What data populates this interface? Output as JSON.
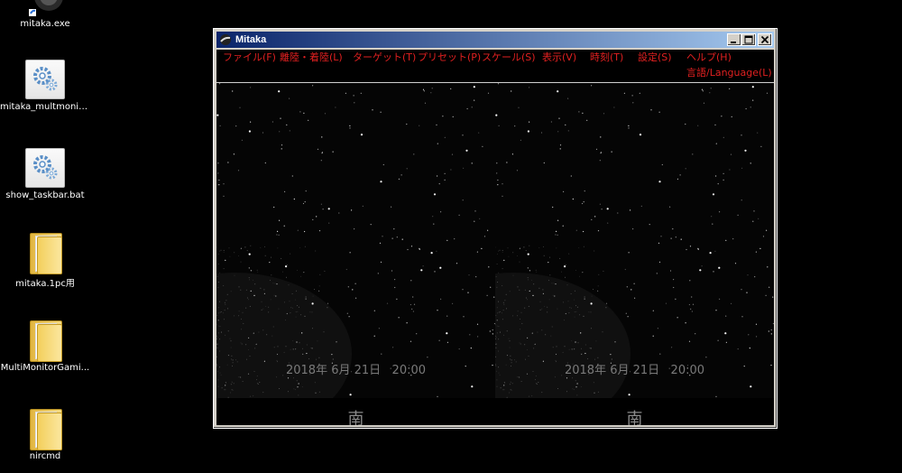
{
  "desktop": {
    "icons": [
      {
        "label": "mitaka.exe",
        "icon": "mitaka-exe-icon"
      },
      {
        "label": "mitaka_multmonit...",
        "icon": "bat-file-icon"
      },
      {
        "label": "show_taskbar.bat",
        "icon": "bat-file-icon"
      },
      {
        "label": "mitaka.1pc用",
        "icon": "folder-icon"
      },
      {
        "label": "MultiMonitorGami...",
        "icon": "folder-icon"
      },
      {
        "label": "nircmd",
        "icon": "folder-icon"
      }
    ]
  },
  "window": {
    "title": "Mitaka",
    "controls": [
      "minimize",
      "maximize",
      "close"
    ],
    "menu": [
      "ファイル(F)",
      "離陸・着陸(L)",
      "ターゲット(T)",
      "プリセット(P)",
      "スケール(S)",
      "表示(V)",
      "時刻(T)",
      "設定(S)",
      "ヘルプ(H)",
      "言語/Language(L)"
    ],
    "views": [
      {
        "date": "2018年 6月 21日   20:00",
        "direction": "南"
      },
      {
        "date": "2018年 6月 21日   20:00",
        "direction": "南"
      }
    ]
  },
  "colors": {
    "menu_text": "#e02020",
    "title_gradient_start": "#0a246a",
    "title_gradient_end": "#a6caf0"
  }
}
